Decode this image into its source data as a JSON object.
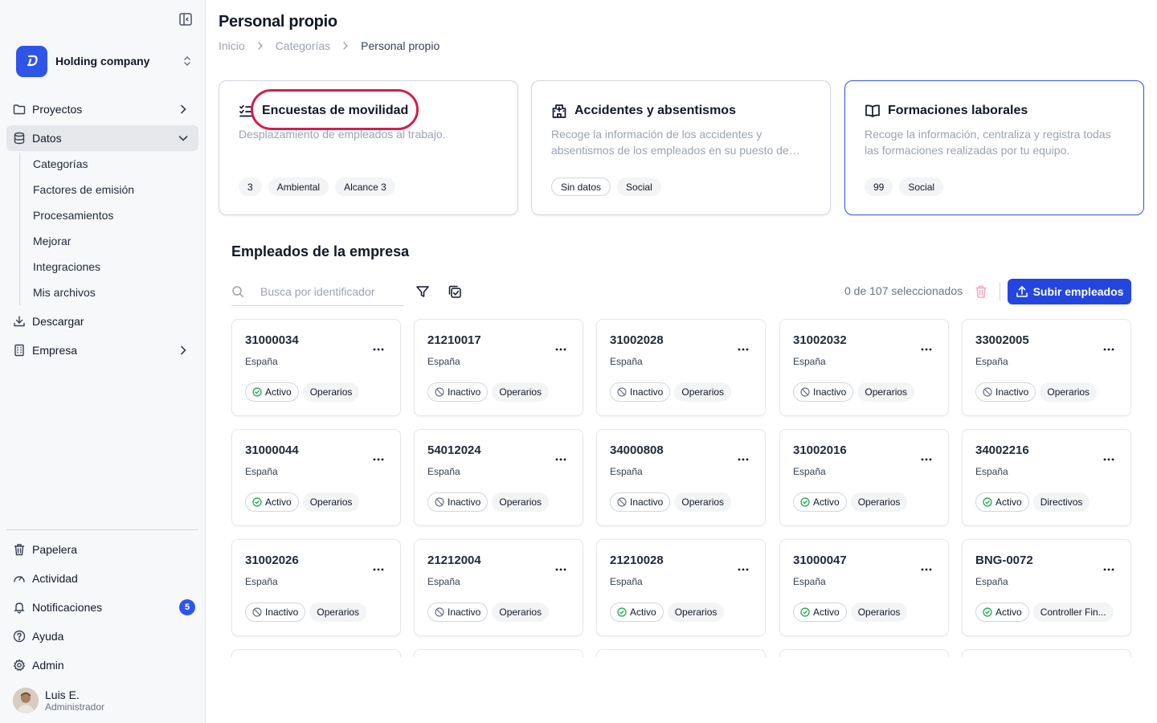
{
  "sidebar": {
    "org_name": "Holding company",
    "nav": {
      "proyectos": "Proyectos",
      "datos": "Datos",
      "descargar": "Descargar",
      "empresa": "Empresa",
      "papelera": "Papelera",
      "actividad": "Actividad",
      "notificaciones": "Notificaciones",
      "ayuda": "Ayuda",
      "admin": "Admin"
    },
    "datos_sub": [
      "Categorías",
      "Factores de emisión",
      "Procesamientos",
      "Mejorar",
      "Integraciones",
      "Mis archivos"
    ],
    "notifications_count": "5",
    "user": {
      "name": "Luis E.",
      "role": "Administrador"
    }
  },
  "header": {
    "title": "Personal propio",
    "breadcrumb": [
      "Inicio",
      "Categorías",
      "Personal propio"
    ]
  },
  "categories": [
    {
      "title": "Encuestas de movilidad",
      "icon": "checklist-icon",
      "description": "Desplazamiento de empleados al trabajo.",
      "tags": [
        "3",
        "Ambiental",
        "Alcance 3"
      ]
    },
    {
      "title": "Accidentes y absentismos",
      "icon": "hospital-icon",
      "description": "Recoge la información de los accidentes y absentismos de los empleados en su puesto de trabajo.",
      "tags": [
        "Sin datos",
        "Social"
      ]
    },
    {
      "title": "Formaciones laborales",
      "icon": "book-icon",
      "description": "Recoge la información, centraliza y registra todas las formaciones realizadas por tu equipo.",
      "tags": [
        "99",
        "Social"
      ]
    }
  ],
  "employees": {
    "section_title": "Empleados de la empresa",
    "search_placeholder": "Busca por identificador",
    "selection_text": "0 de 107 seleccionados",
    "upload_label": "Subir empleados",
    "colors": {
      "accent": "#2346e0",
      "active": "#16a34a",
      "highlight": "#d21f4b"
    },
    "cards": [
      {
        "id": "31000034",
        "country": "España",
        "status": "Activo",
        "role": "Operarios"
      },
      {
        "id": "21210017",
        "country": "España",
        "status": "Inactivo",
        "role": "Operarios"
      },
      {
        "id": "31002028",
        "country": "España",
        "status": "Inactivo",
        "role": "Operarios"
      },
      {
        "id": "31002032",
        "country": "España",
        "status": "Inactivo",
        "role": "Operarios"
      },
      {
        "id": "33002005",
        "country": "España",
        "status": "Inactivo",
        "role": "Operarios"
      },
      {
        "id": "31000044",
        "country": "España",
        "status": "Activo",
        "role": "Operarios"
      },
      {
        "id": "54012024",
        "country": "España",
        "status": "Inactivo",
        "role": "Operarios"
      },
      {
        "id": "34000808",
        "country": "España",
        "status": "Inactivo",
        "role": "Operarios"
      },
      {
        "id": "31002016",
        "country": "España",
        "status": "Activo",
        "role": "Operarios"
      },
      {
        "id": "34002216",
        "country": "España",
        "status": "Activo",
        "role": "Directivos"
      },
      {
        "id": "31002026",
        "country": "España",
        "status": "Inactivo",
        "role": "Operarios"
      },
      {
        "id": "21212004",
        "country": "España",
        "status": "Inactivo",
        "role": "Operarios"
      },
      {
        "id": "21210028",
        "country": "España",
        "status": "Activo",
        "role": "Operarios"
      },
      {
        "id": "31000047",
        "country": "España",
        "status": "Activo",
        "role": "Operarios"
      },
      {
        "id": "BNG-0072",
        "country": "España",
        "status": "Activo",
        "role": "Controller Fin..."
      }
    ]
  }
}
